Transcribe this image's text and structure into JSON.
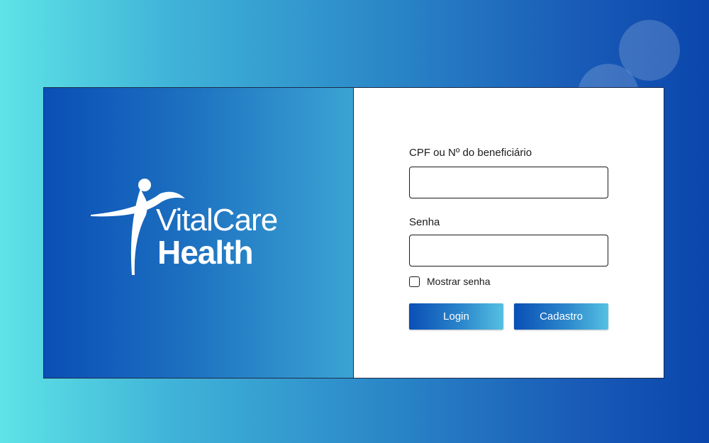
{
  "brand": {
    "name_line1": "VitalCare",
    "name_line2": "Health",
    "logo_icon": "person-figure-icon"
  },
  "form": {
    "cpf_label": "CPF ou Nº do beneficiário",
    "cpf_value": "",
    "password_label": "Senha",
    "password_value": "",
    "show_password_label": "Mostrar senha",
    "show_password_checked": false,
    "login_button": "Login",
    "signup_button": "Cadastro"
  },
  "colors": {
    "brand_blue": "#0a4fb6",
    "accent_cyan": "#5ee3e6",
    "text": "#1a1a1a"
  }
}
